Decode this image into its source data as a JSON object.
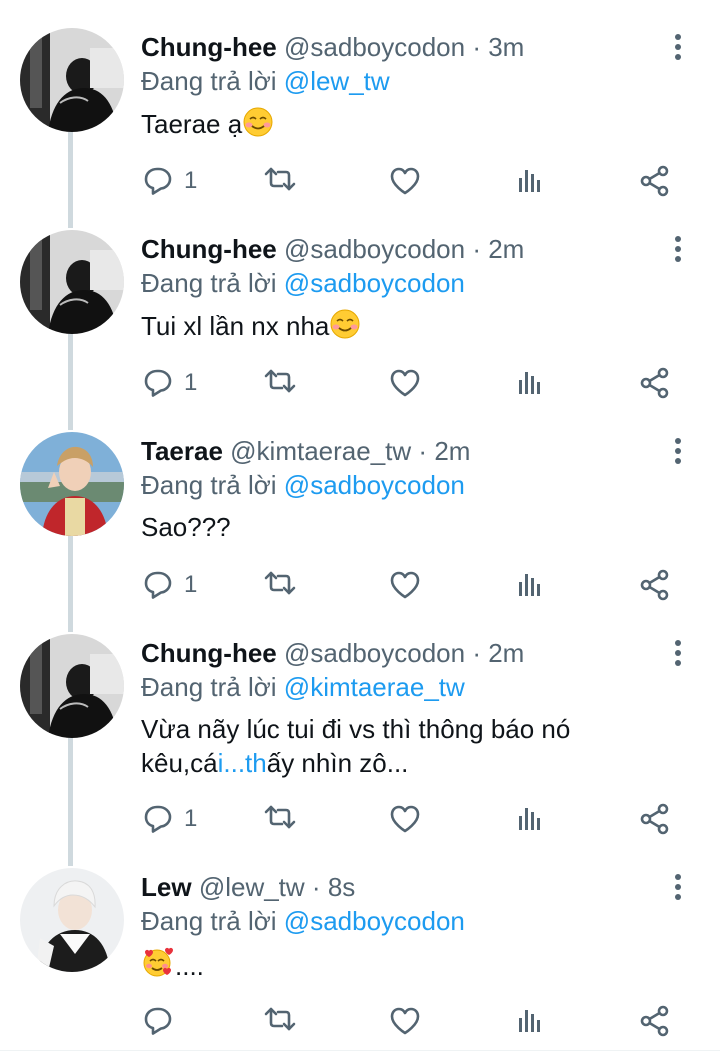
{
  "tweets": [
    {
      "name": "Chung-hee",
      "handle": "@sadboycodon",
      "separator": "·",
      "time": "3m",
      "reply_prefix": "Đang trả lời",
      "reply_to": "@lew_tw",
      "text": "Taerae ạ",
      "text_emoji": "smiling-face-icon",
      "reply_count": "1",
      "avatar": "dark-photo-avatar"
    },
    {
      "name": "Chung-hee",
      "handle": "@sadboycodon",
      "separator": "·",
      "time": "2m",
      "reply_prefix": "Đang trả lời",
      "reply_to": "@sadboycodon",
      "text": "Tui xl lần nx nha",
      "text_emoji": "smiling-face-icon",
      "reply_count": "1",
      "avatar": "dark-photo-avatar"
    },
    {
      "name": "Taerae",
      "handle": "@kimtaerae_tw",
      "separator": "·",
      "time": "2m",
      "reply_prefix": "Đang trả lời",
      "reply_to": "@sadboycodon",
      "text": "Sao???",
      "reply_count": "1",
      "avatar": "red-uniform-avatar"
    },
    {
      "name": "Chung-hee",
      "handle": "@sadboycodon",
      "separator": "·",
      "time": "2m",
      "reply_prefix": "Đang trả lời",
      "reply_to": "@kimtaerae_tw",
      "text_line1": "Vừa nãy lúc tui đi vs thì thông báo nó",
      "text_line2_a": "kêu,cá",
      "text_line2_b": "i...th",
      "text_line2_c": "ấy nhìn zô...",
      "reply_count": "1",
      "avatar": "dark-photo-avatar"
    },
    {
      "name": "Lew",
      "handle": "@lew_tw",
      "separator": "·",
      "time": "8s",
      "reply_prefix": "Đang trả lời",
      "reply_to": "@sadboycodon",
      "text": "....",
      "text_emoji": "smiling-face-with-hearts-icon",
      "reply_count": "",
      "avatar": "white-hair-avatar"
    }
  ],
  "colors": {
    "link": "#1d9bf0",
    "secondary": "#536471",
    "thread_line": "#cfd9de"
  }
}
